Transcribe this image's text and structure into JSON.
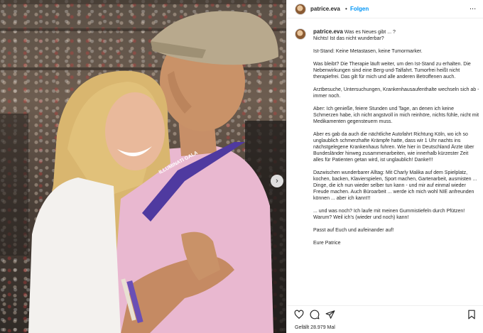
{
  "post": {
    "username": "patrice.eva",
    "follow_label": "Folgen",
    "separator": "•",
    "more_label": "...",
    "likes_text": "Gefällt 28.979 Mal"
  },
  "caption": {
    "opening_rest": "Was es Neues gibt ... ?\nNichts! Ist das nicht wunderbar?",
    "paragraphs": [
      "Ist-Stand: Keine Metastasen, keine Tumormarker.",
      "Was bleibt? Die Therapie läuft weiter, um den Ist-Stand zu erhalten. Die Nebenwirkungen sind eine Berg-und-Talfahrt. Tumorfrei heißt nicht therapiefrei. Das gilt für mich und alle anderen Betroffenen auch.",
      "Arztbesuche, Untersuchungen, Krankenhausaufenthalte wechseln sich ab - immer noch.",
      "Aber: Ich genieße, feiere Stunden und Tage, an denen ich keine Schmerzen habe, ich nicht angstvoll in mich reinhöre, nichts fühle, nicht mit Medikamenten gegensteuern muss.",
      "Aber es gab da auch die nächtliche Autofahrt Richtung Köln, wo ich so unglaublich schmerzhafte Krämpfe hatte, dass wir 1 Uhr nachts ins nächstgelegene Krankenhaus fuhren. Wie hier in Deutschland Ärzte über Bundesländer hinweg zusammenarbeiten, wie innerhalb kürzester Zeit alles für Patienten getan wird, ist unglaublich! Danke!!!",
      "Dazwischen wunderbarer Alltag: Mit Charly Malika auf dem Spielplatz, kochen, backen, Klavierspielen, Sport machen, Gartenarbeit, ausmisten ... Dinge, die ich nun wieder selber tun kann - und mir auf einmal wieder Freude machen. Auch Büroarbeit ... werde ich mich wohl NIE anfreunden können ... aber ich kann!!!",
      "... und was noch? Ich laufe mit meinen Gummistiefeln durch Pfützen! Warum? Weil ich's (wieder und noch) kann!",
      "Passt auf Euch und aufeinander auf!",
      "Eure Patrice"
    ]
  },
  "photo": {
    "lanyard_text": "ILLUMINATI GALA"
  },
  "icons": {
    "next": "chevron-right-icon",
    "like": "heart-icon",
    "comment": "comment-icon",
    "share": "share-icon",
    "save": "bookmark-icon"
  }
}
